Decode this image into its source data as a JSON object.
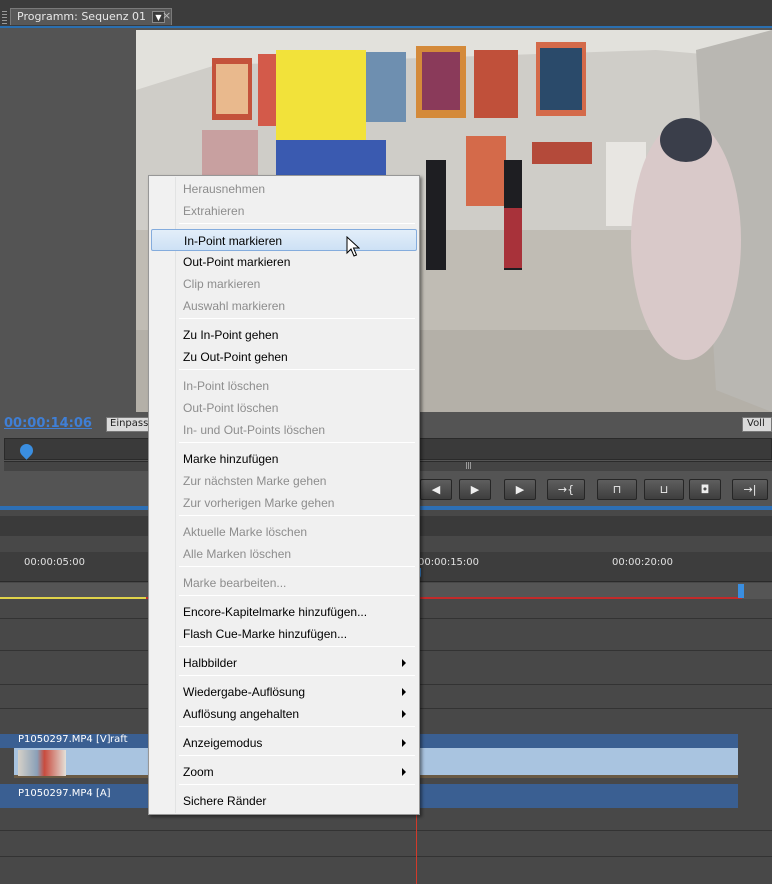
{
  "monitor": {
    "tab_title": "Programm: Sequenz 01",
    "timecode": "00:00:14:06",
    "fit_label": "Einpassen",
    "quality_label": "Voll",
    "transport": [
      "step-back-icon",
      "play-icon",
      "step-forward-icon",
      "shuttle-icon",
      "lift-icon",
      "extract-icon",
      "camera-icon",
      "goto-out-icon"
    ]
  },
  "timeline": {
    "ruler_ticks": [
      "00:00:05:00",
      "00:00:15:00",
      "00:00:20:00"
    ],
    "video_clip_label": "P1050297.MP4 [V]",
    "video_fx_label": "raft",
    "audio_clip_label": "P1050297.MP4 [A]"
  },
  "context_menu": {
    "items": [
      {
        "label": "Herausnehmen",
        "enabled": false
      },
      {
        "label": "Extrahieren",
        "enabled": false
      },
      {
        "label": "In-Point markieren",
        "enabled": true,
        "highlighted": true
      },
      {
        "label": "Out-Point markieren",
        "enabled": true
      },
      {
        "label": "Clip markieren",
        "enabled": false
      },
      {
        "label": "Auswahl markieren",
        "enabled": false
      },
      {
        "label": "Zu In-Point gehen",
        "enabled": true
      },
      {
        "label": "Zu Out-Point gehen",
        "enabled": true
      },
      {
        "label": "In-Point löschen",
        "enabled": false
      },
      {
        "label": "Out-Point löschen",
        "enabled": false
      },
      {
        "label": "In- und Out-Points löschen",
        "enabled": false
      },
      {
        "label": "Marke hinzufügen",
        "enabled": true
      },
      {
        "label": "Zur nächsten Marke gehen",
        "enabled": false
      },
      {
        "label": "Zur vorherigen Marke gehen",
        "enabled": false
      },
      {
        "label": "Aktuelle Marke löschen",
        "enabled": false
      },
      {
        "label": "Alle Marken löschen",
        "enabled": false
      },
      {
        "label": "Marke bearbeiten...",
        "enabled": false
      },
      {
        "label": "Encore-Kapitelmarke hinzufügen...",
        "enabled": true
      },
      {
        "label": "Flash Cue-Marke hinzufügen...",
        "enabled": true
      },
      {
        "label": "Halbbilder",
        "enabled": true,
        "submenu": true
      },
      {
        "label": "Wiedergabe-Auflösung",
        "enabled": true,
        "submenu": true
      },
      {
        "label": "Auflösung angehalten",
        "enabled": true,
        "submenu": true
      },
      {
        "label": "Anzeigemodus",
        "enabled": true,
        "submenu": true
      },
      {
        "label": "Zoom",
        "enabled": true,
        "submenu": true
      },
      {
        "label": "Sichere Ränder",
        "enabled": true
      }
    ]
  },
  "colors": {
    "accent": "#3a8ee0",
    "timecode": "#3f7fd6",
    "playhead_line": "#d23a2a",
    "menu_highlight_border": "#84acdd"
  }
}
